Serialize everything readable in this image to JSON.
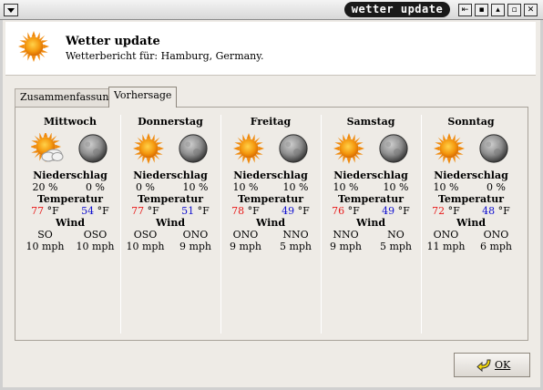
{
  "window": {
    "title": "wetter update"
  },
  "header": {
    "title": "Wetter update",
    "subtitle": "Wetterbericht für: Hamburg, Germany."
  },
  "tabs": [
    {
      "label": "Zusammenfassung"
    },
    {
      "label": "Vorhersage"
    }
  ],
  "labels": {
    "precip": "Niederschlag",
    "temp": "Temperatur",
    "wind": "Wind",
    "unit": "°F"
  },
  "days": [
    {
      "name": "Mittwoch",
      "day_icon": "sun-cloud-icon",
      "night_icon": "moon-icon",
      "precip_day": "20 %",
      "precip_night": "0 %",
      "hi": "77",
      "lo": "54",
      "wind_dir_day": "SO",
      "wind_dir_night": "OSO",
      "wind_speed_day": "10 mph",
      "wind_speed_night": "10 mph"
    },
    {
      "name": "Donnerstag",
      "day_icon": "sun-icon",
      "night_icon": "moon-icon",
      "precip_day": "0 %",
      "precip_night": "10 %",
      "hi": "77",
      "lo": "51",
      "wind_dir_day": "OSO",
      "wind_dir_night": "ONO",
      "wind_speed_day": "10 mph",
      "wind_speed_night": "9 mph"
    },
    {
      "name": "Freitag",
      "day_icon": "sun-icon",
      "night_icon": "moon-icon",
      "precip_day": "10 %",
      "precip_night": "10 %",
      "hi": "78",
      "lo": "49",
      "wind_dir_day": "ONO",
      "wind_dir_night": "NNO",
      "wind_speed_day": "9 mph",
      "wind_speed_night": "5 mph"
    },
    {
      "name": "Samstag",
      "day_icon": "sun-icon",
      "night_icon": "moon-icon",
      "precip_day": "10 %",
      "precip_night": "10 %",
      "hi": "76",
      "lo": "49",
      "wind_dir_day": "NNO",
      "wind_dir_night": "NO",
      "wind_speed_day": "9 mph",
      "wind_speed_night": "5 mph"
    },
    {
      "name": "Sonntag",
      "day_icon": "sun-icon",
      "night_icon": "moon-icon",
      "precip_day": "10 %",
      "precip_night": "0 %",
      "hi": "72",
      "lo": "48",
      "wind_dir_day": "ONO",
      "wind_dir_night": "ONO",
      "wind_speed_day": "11 mph",
      "wind_speed_night": "6 mph"
    }
  ],
  "buttons": {
    "ok": "OK"
  },
  "colors": {
    "high_temp": "#e81818",
    "low_temp": "#1010d0"
  }
}
